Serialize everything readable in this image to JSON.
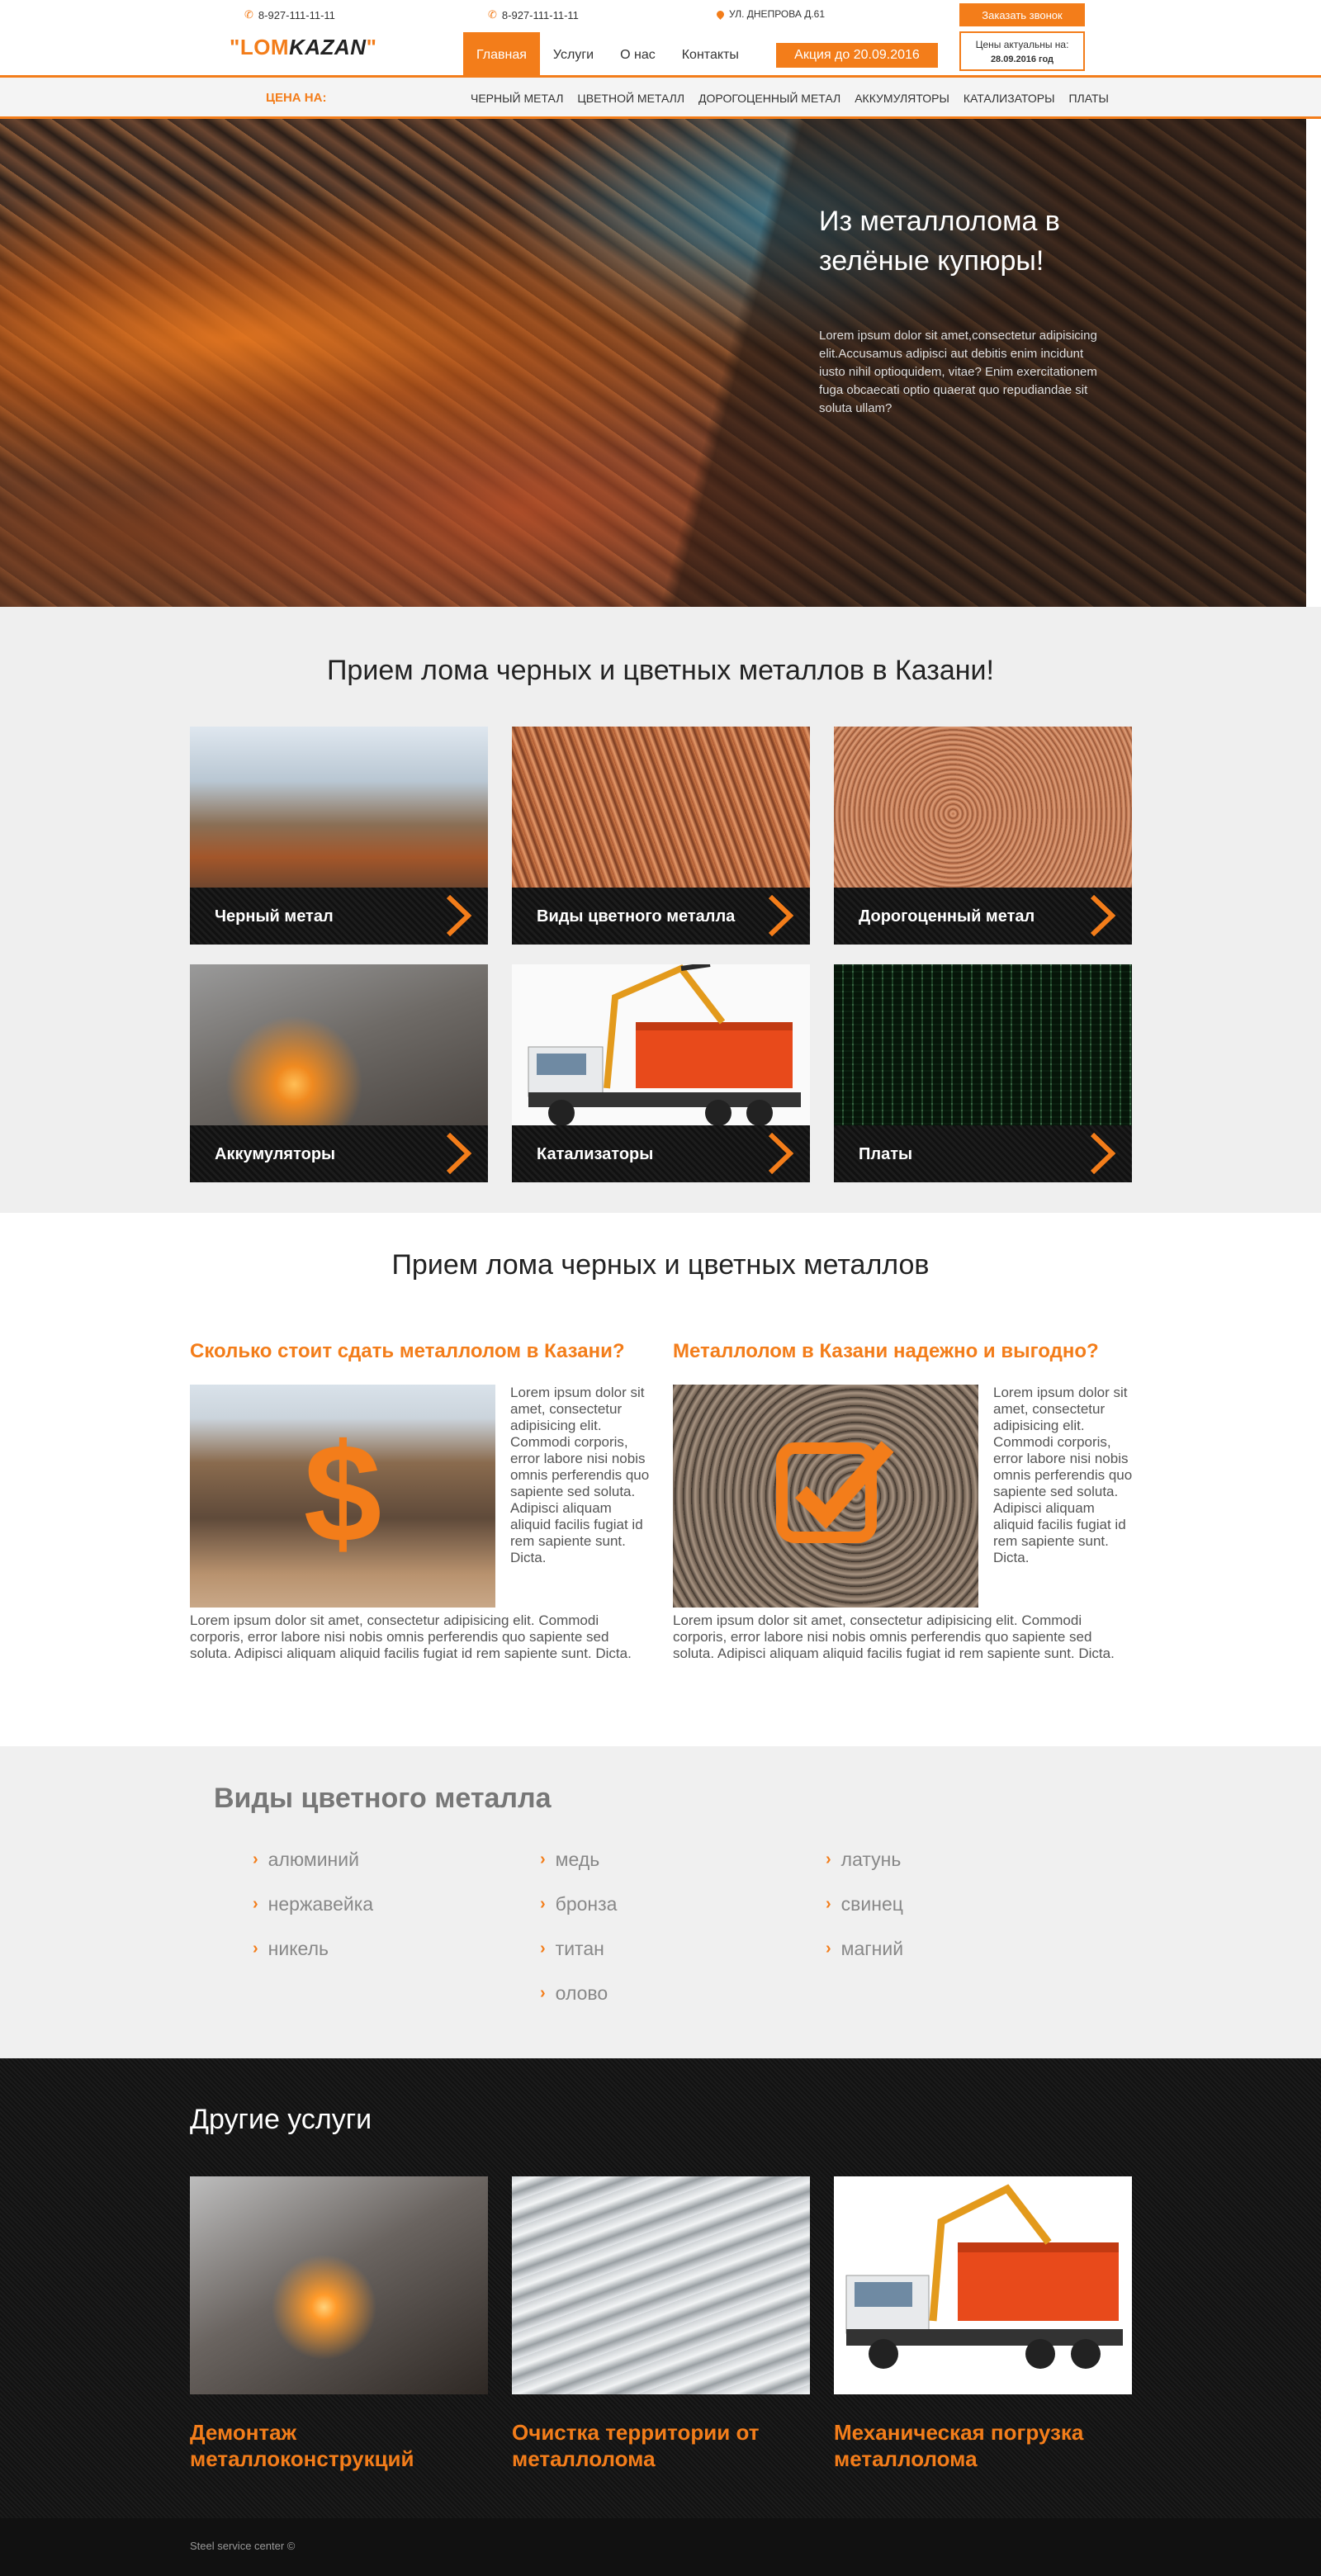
{
  "header": {
    "phone1": "8-927-111-11-11",
    "phone2": "8-927-111-11-11",
    "address": "ул. Днепрова д.61",
    "callback_button": "Заказать звонок",
    "logo_quote_open": "\"",
    "logo_lom": "LOM",
    "logo_kazan": "KAZAN",
    "logo_quote_close": "\"",
    "nav": [
      "Главная",
      "Услуги",
      "О нас",
      "Контакты"
    ],
    "promo": "Акция до 20.09.2016",
    "prices_label": "Цены актуальны на:",
    "prices_date": "28.09.2016 год"
  },
  "subnav": {
    "label": "ЦЕНА НА:",
    "links": [
      "черный метал",
      "цветной металл",
      "дорогоценный метал",
      "аккумуляторы",
      "катализаторы",
      "платы"
    ]
  },
  "hero": {
    "title": "Из металлолома в зелёные купюры!",
    "text": "Lorem ipsum dolor sit amet,consectetur adipisicing elit.Accusamus adipisci aut debitis enim incidunt iusto nihil optioquidem, vitae? Enim exercitationem fuga obcaecati optio quaerat quo repudiandae sit soluta ullam?"
  },
  "categories": {
    "title": "Прием лома черных и цветных металлов в Казани!",
    "items": [
      "Черный метал",
      "Виды цветного металла",
      "Дорогоценный метал",
      "Аккумуляторы",
      "Катализаторы",
      "Платы"
    ]
  },
  "info": {
    "title": "Прием лома черных и цветных металлов",
    "left_heading": "Сколько стоит сдать металлолом в Казани?",
    "right_heading": "Металлолом в Казани надежно и выгодно?",
    "side_text": "Lorem ipsum dolor sit amet, consectetur adipisicing elit. Commodi corporis, error labore nisi nobis omnis perferendis quo sapiente sed soluta. Adipisci aliquam aliquid facilis fugiat id rem sapiente sunt. Dicta.",
    "bottom_text": "Lorem ipsum dolor sit amet, consectetur adipisicing elit. Commodi corporis, error labore nisi nobis omnis perferendis quo sapiente sed soluta. Adipisci aliquam aliquid facilis fugiat id rem sapiente sunt. Dicta.",
    "left_icon": "dollar-icon",
    "right_icon": "checkmark-icon"
  },
  "metals": {
    "title": "Виды цветного металла",
    "items": [
      "алюминий",
      "медь",
      "латунь",
      "нержавейка",
      "бронза",
      "свинец",
      "никель",
      "титан",
      "магний",
      "олово"
    ]
  },
  "services": {
    "title": "Другие услуги",
    "items": [
      "Демонтаж металлоконструкций",
      "Очистка территории от металлолома",
      "Механическая погрузка металлолома"
    ]
  },
  "footer": {
    "copyright": "Steel service center ©"
  },
  "colors": {
    "accent": "#f37d1a",
    "dark": "#141414",
    "light_bg": "#efefef"
  }
}
